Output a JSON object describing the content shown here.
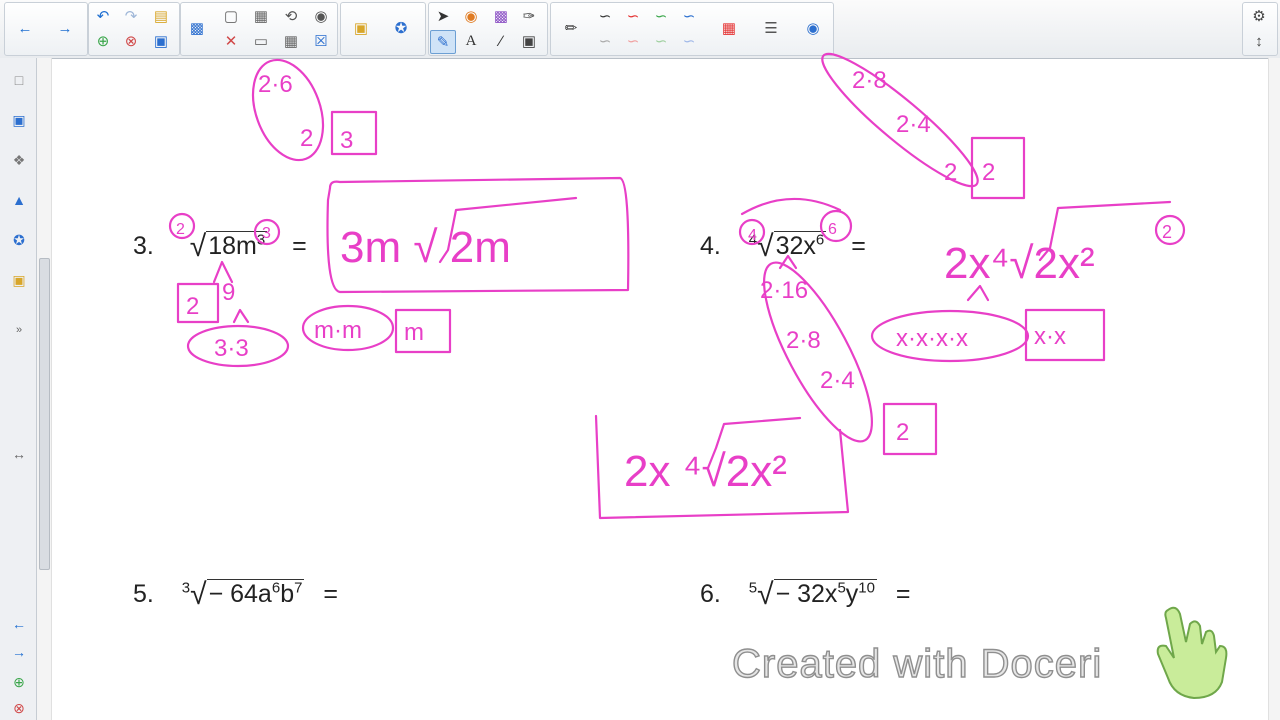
{
  "toolbar": {
    "icons": [
      "back-arrow-icon",
      "forward-arrow-icon",
      "undo-icon",
      "redo-icon",
      "open-folder-icon",
      "add-page-icon",
      "delete-page-icon",
      "save-icon",
      "screen-shade-icon",
      "capture-icon",
      "table-icon",
      "full-screen-icon",
      "select-pointer-icon",
      "fill-icon",
      "eraser-icon",
      "magic-pen-icon",
      "pen-icon",
      "text-icon",
      "line-icon",
      "shape-icon",
      "gallery-icon",
      "properties-icon"
    ],
    "colors": {
      "magenta_ink": "#e83fc7",
      "red_ink": "#e53030",
      "green_ink": "#3aa64a",
      "blue_ink": "#2c6fcf"
    }
  },
  "problems": [
    {
      "number": "3.",
      "index": "",
      "radicand": "18m",
      "exponent": "3",
      "equals": "="
    },
    {
      "number": "4.",
      "index": "4",
      "radicand": "32x",
      "exponent": "6",
      "equals": "="
    },
    {
      "number": "5.",
      "index": "3",
      "radicand": "− 64a",
      "radicand_b": "b",
      "exp_a": "6",
      "exp_b": "7",
      "equals": "="
    },
    {
      "number": "6.",
      "index": "5",
      "radicand": "− 32x",
      "radicand_b": "y",
      "exp_a": "5",
      "exp_b": "10",
      "equals": "="
    }
  ],
  "handwriting": {
    "p3_index": "2",
    "p3_exp_circle": "3",
    "p3_answer": "3m √ 2m",
    "p3_factor_a": "2",
    "p3_factor_b": "9",
    "p3_factor_c": "3·3",
    "p3_m_group": "m·m",
    "p3_m_left": "m",
    "p4_index": "4",
    "p4_exp": "6",
    "p4_factors": [
      "2·16",
      "2·8",
      "2·4",
      "2"
    ],
    "p4_answer_top": "2x⁴√2x²",
    "p4_x_group": "x·x·x·x",
    "p4_x_left": "x·x",
    "p4_circled_two": "2",
    "p4_answer_box": "2x ⁴√2x²",
    "top_left_partial": [
      "2·6",
      "2",
      "3"
    ],
    "top_right_partial": [
      "2·8",
      "2·4",
      "2",
      "2"
    ]
  },
  "watermark": "Created with Doceri"
}
